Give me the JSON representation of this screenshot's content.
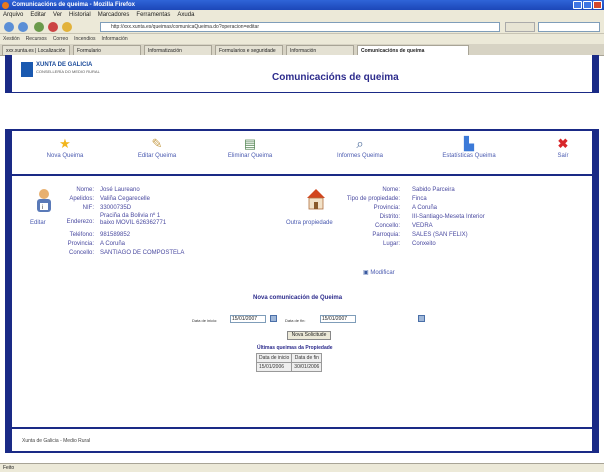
{
  "browser": {
    "window_title": "Comunicacións de queima - Mozilla Firefox",
    "menu": [
      "Arquivo",
      "Editar",
      "Ver",
      "Historial",
      "Marcadores",
      "Ferramentas",
      "Axuda"
    ],
    "url": "http://xxx.xunta.es/queimas/comunicaQueima.do?operacion=editar",
    "bookmarks": [
      "Xestión",
      "Recursos",
      "Correo",
      "Incendios",
      "Información"
    ],
    "tabs": [
      "xxx.xunta.es | Localización",
      "Formulario",
      "Informatización",
      "Formularios e seguridade",
      "Información",
      "Comunicacións de queima"
    ],
    "status": "Feito"
  },
  "header": {
    "logo_line1": "XUNTA DE GALICIA",
    "logo_line2": "CONSELLERÍA DO MEDIO RURAL",
    "title": "Comunicacións de queima"
  },
  "toolbar": [
    {
      "label": "Nova Queima",
      "icon": "star-icon"
    },
    {
      "label": "Editar Queima",
      "icon": "edit-icon"
    },
    {
      "label": "Eliminar Queima",
      "icon": "delete-doc-icon"
    },
    {
      "label": "Informes Queima",
      "icon": "search-icon"
    },
    {
      "label": "Estatísticas Queima",
      "icon": "chart-icon"
    },
    {
      "label": "Saír",
      "icon": "close-icon"
    }
  ],
  "person": {
    "edit_label": "Editar",
    "fields": [
      {
        "label": "Nome:",
        "value": "José Laureano"
      },
      {
        "label": "Apelidos:",
        "value": "Valiña Cegarecelle"
      },
      {
        "label": "NIF:",
        "value": "33000735D"
      },
      {
        "label": "Enderezo:",
        "value": "Praciña da Bolivia nº 1 baixo MOVIL 626362771"
      },
      {
        "label": "Teléfono:",
        "value": "981589852"
      },
      {
        "label": "Provincia:",
        "value": "A Coruña"
      },
      {
        "label": "Concello:",
        "value": "SANTIAGO DE COMPOSTELA"
      }
    ]
  },
  "property": {
    "link_label": "Outra propiedade",
    "modify_label": "Modificar",
    "fields": [
      {
        "label": "Nome:",
        "value": "Sabido Parceira"
      },
      {
        "label": "Tipo de propiedade:",
        "value": "Finca"
      },
      {
        "label": "Provincia:",
        "value": "A Coruña"
      },
      {
        "label": "Distrito:",
        "value": "III-Santiago-Meseta Interior"
      },
      {
        "label": "Concello:",
        "value": "VEDRA"
      },
      {
        "label": "Parroquia:",
        "value": "SALES (SAN FELIX)"
      },
      {
        "label": "Lugar:",
        "value": "Conxeito"
      }
    ]
  },
  "nueva": {
    "title": "Nova comunicación de Queima",
    "start_label": "Data de inicio:",
    "start_value": "15/01/2007",
    "end_label": "Data de fin:",
    "end_value": "15/01/2007",
    "button": "Nova Solicitude"
  },
  "historial": {
    "title": "Últimas queimas da Propiedade",
    "headers": [
      "Data de inicio",
      "Data de fin"
    ],
    "rows": [
      [
        "15/01/2006",
        "30/01/2006"
      ]
    ]
  },
  "footer": {
    "text": "Xunta de Galicia - Medio Rural"
  }
}
